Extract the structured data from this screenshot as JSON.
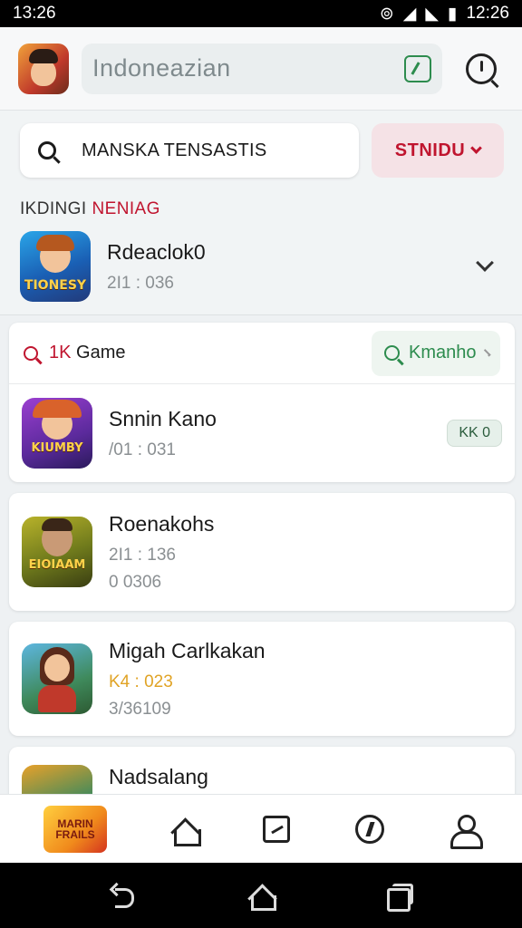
{
  "statusbar": {
    "time": "13:26",
    "clock_right": "12:26"
  },
  "appbar": {
    "title": "Indoneazian"
  },
  "search": {
    "value": "MANSKA TENSASTIS"
  },
  "status_filter": {
    "label": "STNIDU"
  },
  "section": {
    "label_a": "IKDINGI",
    "label_b": "NENIAG"
  },
  "featured": {
    "name": "Rdeaclok0",
    "meta": "2I1 : 036",
    "thumb_text": "TIONESY"
  },
  "category": {
    "prefix": "1K",
    "label": "Game",
    "tag": "Kmanho"
  },
  "games": [
    {
      "name": "Snnin Kano",
      "line1": "/01 : 031",
      "badge": "KK 0",
      "thumb_text": "KIUMBY"
    },
    {
      "name": "Roenakohs",
      "line1": "2I1 : 136",
      "line2": "0 0306",
      "thumb_text": "EIOIAAM"
    },
    {
      "name": "Migah Carlkakan",
      "line1": "K4 : 023",
      "line2": "3/36109"
    },
    {
      "name": "Nadsalang"
    }
  ],
  "bottomnav": {
    "logo_text": "MARIN FRAILS"
  },
  "colors": {
    "accent_red": "#c0152f",
    "accent_green": "#2d8c4e",
    "gold": "#e0a325"
  }
}
